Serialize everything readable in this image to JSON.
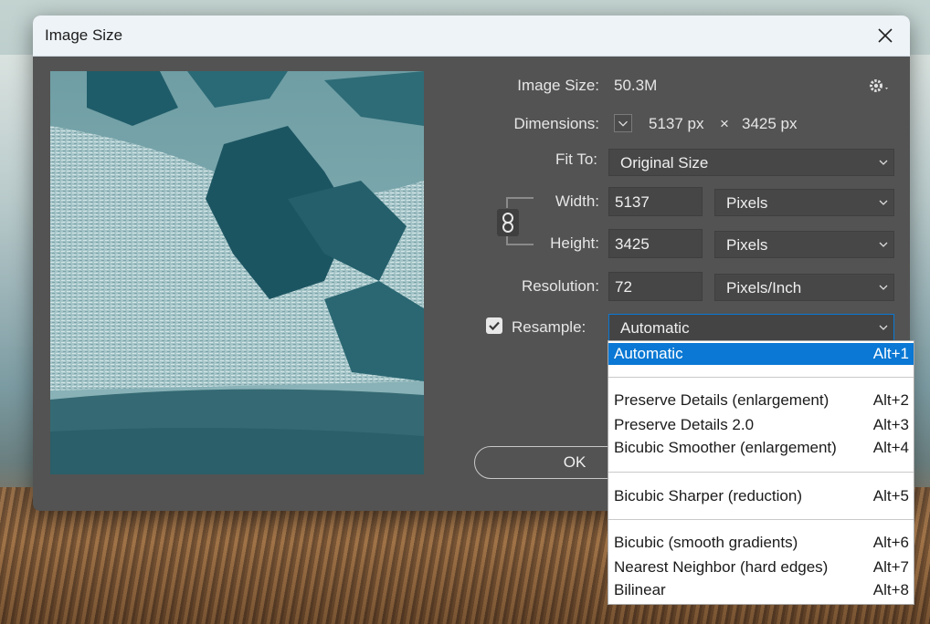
{
  "dialog": {
    "title": "Image Size",
    "close_icon": "close-icon"
  },
  "info": {
    "image_size_label": "Image Size:",
    "image_size_value": "50.3M",
    "dimensions_label": "Dimensions:",
    "dim_width": "5137 px",
    "dim_times": "×",
    "dim_height": "3425 px"
  },
  "fit_to": {
    "label": "Fit To:",
    "value": "Original Size"
  },
  "width": {
    "label": "Width:",
    "value": "5137",
    "unit": "Pixels"
  },
  "height": {
    "label": "Height:",
    "value": "3425",
    "unit": "Pixels"
  },
  "resolution": {
    "label": "Resolution:",
    "value": "72",
    "unit": "Pixels/Inch"
  },
  "resample": {
    "label": "Resample:",
    "checked": true,
    "value": "Automatic"
  },
  "buttons": {
    "ok": "OK"
  },
  "resample_menu": [
    {
      "name": "Automatic",
      "shortcut": "Alt+1"
    },
    {
      "name": "Preserve Details (enlargement)",
      "shortcut": "Alt+2"
    },
    {
      "name": "Preserve Details 2.0",
      "shortcut": "Alt+3"
    },
    {
      "name": "Bicubic Smoother (enlargement)",
      "shortcut": "Alt+4"
    },
    {
      "name": "Bicubic Sharper (reduction)",
      "shortcut": "Alt+5"
    },
    {
      "name": "Bicubic (smooth gradients)",
      "shortcut": "Alt+6"
    },
    {
      "name": "Nearest Neighbor (hard edges)",
      "shortcut": "Alt+7"
    },
    {
      "name": "Bilinear",
      "shortcut": "Alt+8"
    }
  ],
  "colors": {
    "dialog_bg": "#535353",
    "menu_highlight": "#0a78d4"
  }
}
